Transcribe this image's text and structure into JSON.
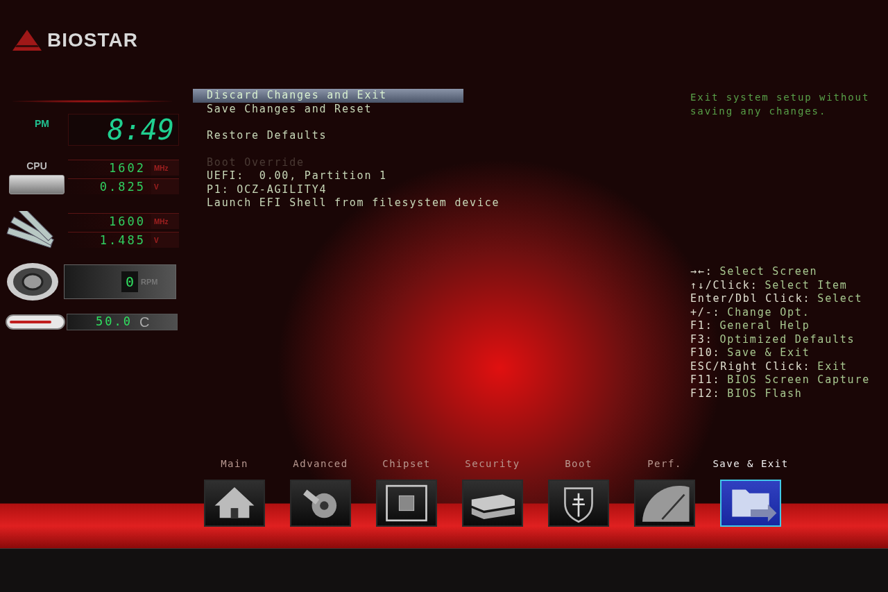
{
  "logo": {
    "text": "BIOSTAR"
  },
  "clock": {
    "period": "PM",
    "time": "8:49"
  },
  "cpu": {
    "label": "CPU",
    "frequency": "1602",
    "frequency_unit": "MHz",
    "voltage": "0.825",
    "voltage_unit": "V"
  },
  "memory": {
    "frequency": "1600",
    "frequency_unit": "MHz",
    "voltage": "1.485",
    "voltage_unit": "V"
  },
  "fan": {
    "speed": "0",
    "unit": "RPM"
  },
  "temperature": {
    "value": "50.0",
    "unit": "C"
  },
  "menu": {
    "groups": [
      [
        {
          "kind": "item",
          "label": "Discard Changes and Exit",
          "selected": true
        },
        {
          "kind": "item",
          "label": "Save Changes and Reset",
          "selected": false
        }
      ],
      [
        {
          "kind": "item",
          "label": "Restore Defaults",
          "selected": false
        }
      ],
      [
        {
          "kind": "heading",
          "label": "Boot Override",
          "selected": false
        },
        {
          "kind": "item",
          "label": "UEFI:  0.00, Partition 1",
          "selected": false
        },
        {
          "kind": "item",
          "label": "P1: OCZ-AGILITY4",
          "selected": false
        },
        {
          "kind": "item",
          "label": "Launch EFI Shell from filesystem device",
          "selected": false
        }
      ]
    ]
  },
  "help": {
    "text": "Exit system setup without saving any changes."
  },
  "keys": [
    {
      "key": "→←:",
      "action": "Select Screen"
    },
    {
      "key": "↑↓/Click:",
      "action": "Select Item"
    },
    {
      "key": "Enter/Dbl Click:",
      "action": "Select"
    },
    {
      "key": "+/-:",
      "action": "Change Opt."
    },
    {
      "key": "F1:",
      "action": "General Help"
    },
    {
      "key": "F3:",
      "action": "Optimized Defaults"
    },
    {
      "key": "F10:",
      "action": "Save & Exit"
    },
    {
      "key": "ESC/Right Click:",
      "action": "Exit"
    },
    {
      "key": "F11:",
      "action": "BIOS Screen Capture"
    },
    {
      "key": "F12:",
      "action": "BIOS Flash"
    }
  ],
  "tabs": [
    {
      "label": "Main",
      "kind": "home",
      "selected": false
    },
    {
      "label": "Advanced",
      "kind": "disc",
      "selected": false
    },
    {
      "label": "Chipset",
      "kind": "chip",
      "selected": false
    },
    {
      "label": "Security",
      "kind": "drive",
      "selected": false
    },
    {
      "label": "Boot",
      "kind": "shield",
      "selected": false
    },
    {
      "label": "Perf.",
      "kind": "gauge",
      "selected": false
    },
    {
      "label": "Save & Exit",
      "kind": "folder",
      "selected": true
    }
  ]
}
